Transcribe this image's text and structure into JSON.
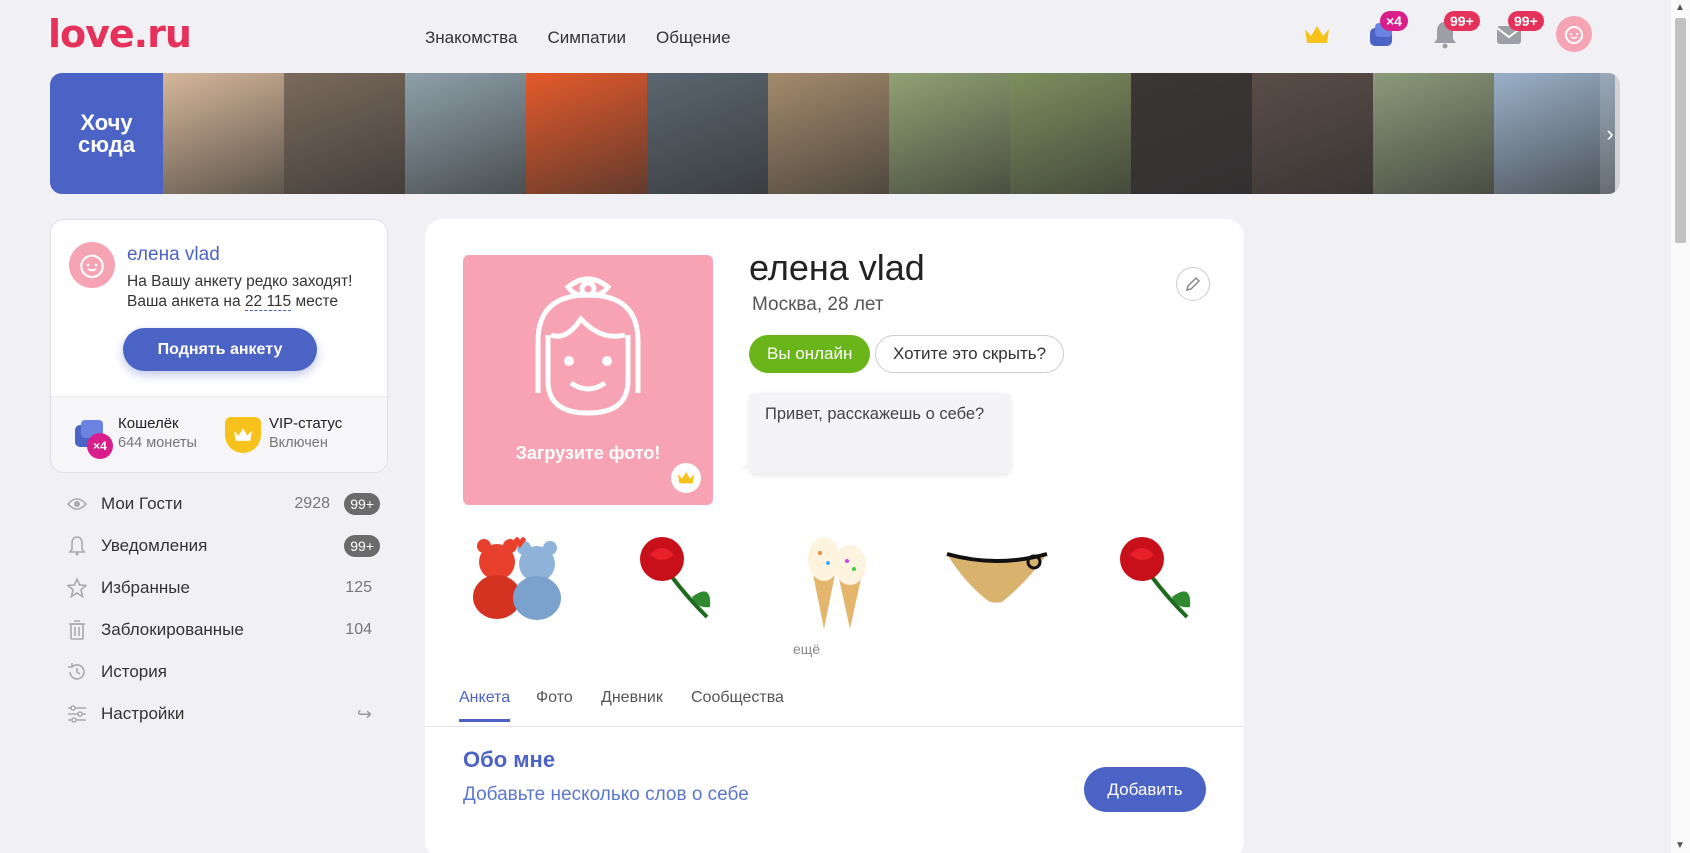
{
  "header": {
    "logo": "love.ru",
    "nav": [
      "Знакомства",
      "Симпатии",
      "Общение"
    ],
    "coins_badge": "×4",
    "notifications_badge": "99+",
    "messages_badge": "99+"
  },
  "strip": {
    "cta": "Хочу сюда",
    "photos": [
      {
        "name": "woman-blonde",
        "bg": "#d6b79a"
      },
      {
        "name": "man-gym",
        "bg": "#7a6a5c"
      },
      {
        "name": "woman-beach",
        "bg": "#8fa0aa"
      },
      {
        "name": "man-orange-hat",
        "bg": "#e55a2b"
      },
      {
        "name": "man-car",
        "bg": "#5b6670"
      },
      {
        "name": "woman-sunglasses",
        "bg": "#a48a6c"
      },
      {
        "name": "man-grill",
        "bg": "#91a273"
      },
      {
        "name": "woman-garden",
        "bg": "#7d8f5e"
      },
      {
        "name": "man-dark-room",
        "bg": "#3c3636"
      },
      {
        "name": "man-suit",
        "bg": "#5a4d47"
      },
      {
        "name": "man-outdoor",
        "bg": "#8c9a7a"
      },
      {
        "name": "man-selfie",
        "bg": "#9ab0c8"
      }
    ]
  },
  "left_card": {
    "name": "елена vlad",
    "text_line1": "На Вашу анкету редко заходят!",
    "text_line2_prefix": "Ваша анкета на",
    "rank": "22 115",
    "text_line2_suffix": "месте",
    "raise_button": "Поднять анкету",
    "wallet_title": "Кошелёк",
    "wallet_sub": "644 монеты",
    "wallet_badge": "×4",
    "vip_title": "VIP-статус",
    "vip_sub": "Включен"
  },
  "menu": [
    {
      "label": "Мои Гости",
      "count": "2928",
      "badge": "99+",
      "icon": "eye-icon"
    },
    {
      "label": "Уведомления",
      "count": "",
      "badge": "99+",
      "icon": "bell-icon"
    },
    {
      "label": "Избранные",
      "count": "125",
      "badge": "",
      "icon": "star-icon"
    },
    {
      "label": "Заблокированные",
      "count": "104",
      "badge": "",
      "icon": "trash-icon"
    },
    {
      "label": "История",
      "count": "",
      "badge": "",
      "icon": "history-icon"
    },
    {
      "label": "Настройки",
      "count": "",
      "badge": "",
      "icon": "settings-icon"
    }
  ],
  "profile": {
    "upload_photo": "Загрузите фото!",
    "name": "елена vlad",
    "city_age": "Москва, 28 лет",
    "online": "Вы онлайн",
    "hide": "Хотите это скрыть?",
    "greeting": "Привет, расскажешь о себе?",
    "gifts_more": "ещё",
    "tabs": [
      "Анкета",
      "Фото",
      "Дневник",
      "Сообщества"
    ],
    "about_title": "Обо мне",
    "about_hint": "Добавьте несколько слов о себе",
    "add_button": "Добавить"
  },
  "colors": {
    "brand_red": "#e6325b",
    "brand_blue": "#4b63c4",
    "online_green": "#6ab51a",
    "vip_yellow": "#f7c21b",
    "avatar_pink": "#f7a3b4"
  }
}
